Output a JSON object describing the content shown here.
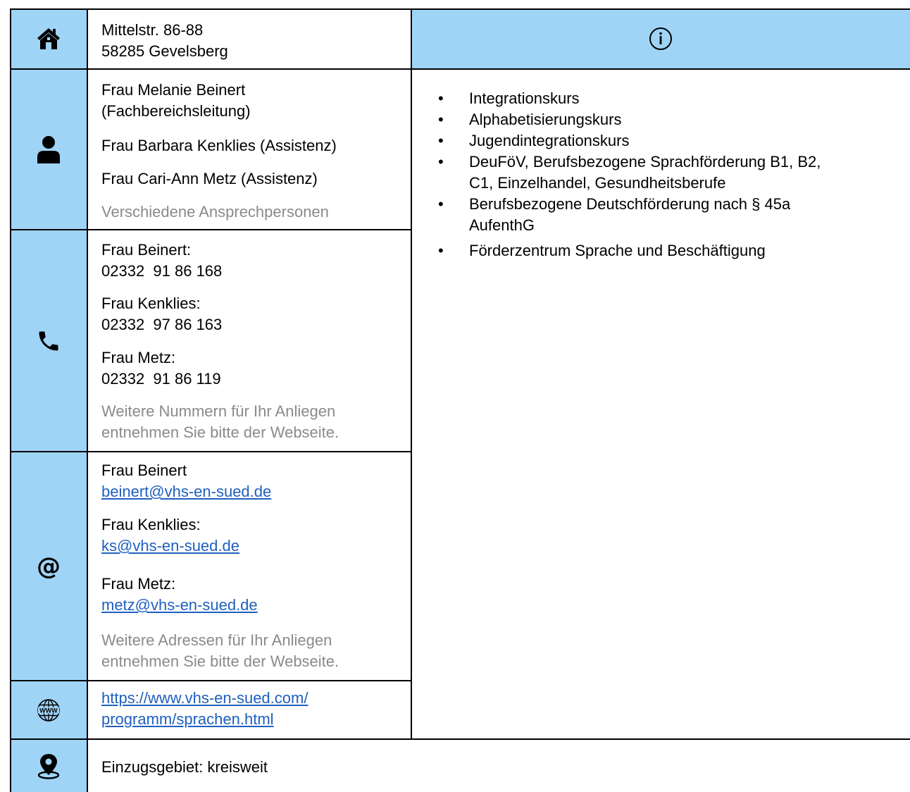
{
  "address": {
    "street": "Mittelstr. 86-88",
    "city": "58285 Gevelsberg"
  },
  "icons": {
    "home": "home-icon",
    "info": "info-icon",
    "person": "person-icon",
    "phone": "phone-icon",
    "email": "at-icon",
    "web": "www-globe-icon",
    "location": "location-pin-icon"
  },
  "contacts": {
    "person1_line1": "Frau Melanie Beinert",
    "person1_line2": "(Fachbereichsleitung)",
    "person2": "Frau Barbara Kenklies (Assistenz)",
    "person3": "Frau Cari-Ann Metz (Assistenz)",
    "note": "Verschiedene Ansprechpersonen"
  },
  "phones": {
    "p1_name": "Frau Beinert:",
    "p1_number": "02332  91 86 168",
    "p2_name": "Frau Kenklies:",
    "p2_number": "02332  97 86 163",
    "p3_name": "Frau Metz:",
    "p3_number": "02332  91 86 119",
    "note_line1": "Weitere Nummern für Ihr Anliegen",
    "note_line2": "entnehmen Sie bitte der Webseite."
  },
  "emails": {
    "e1_name": "Frau Beinert",
    "e1_address": "beinert@vhs-en-sued.de",
    "e2_name": "Frau Kenklies:",
    "e2_address": "ks@vhs-en-sued.de",
    "e3_name": "Frau Metz:",
    "e3_address": "metz@vhs-en-sued.de",
    "note_line1": "Weitere Adressen für Ihr Anliegen",
    "note_line2": "entnehmen Sie bitte der Webseite."
  },
  "website": {
    "line1": "https://www.vhs-en-sued.com/",
    "line2": "programm/sprachen.html"
  },
  "services": [
    "Integrationskurs",
    "Alphabetisierungskurs",
    "Jugendintegrationskurs",
    "DeuFöV, Berufsbezogene Sprachförderung B1, B2,",
    "C1, Einzelhandel, Gesundheitsberufe",
    "Berufsbezogene Deutschförderung nach § 45a",
    "AufenthG",
    "Förderzentrum Sprache und Beschäftigung"
  ],
  "catchment": "Einzugsgebiet: kreisweit",
  "colors": {
    "header_blue": "#9fd4f7",
    "link_blue": "#1f5fbf",
    "note_gray": "#8a8a8a"
  }
}
